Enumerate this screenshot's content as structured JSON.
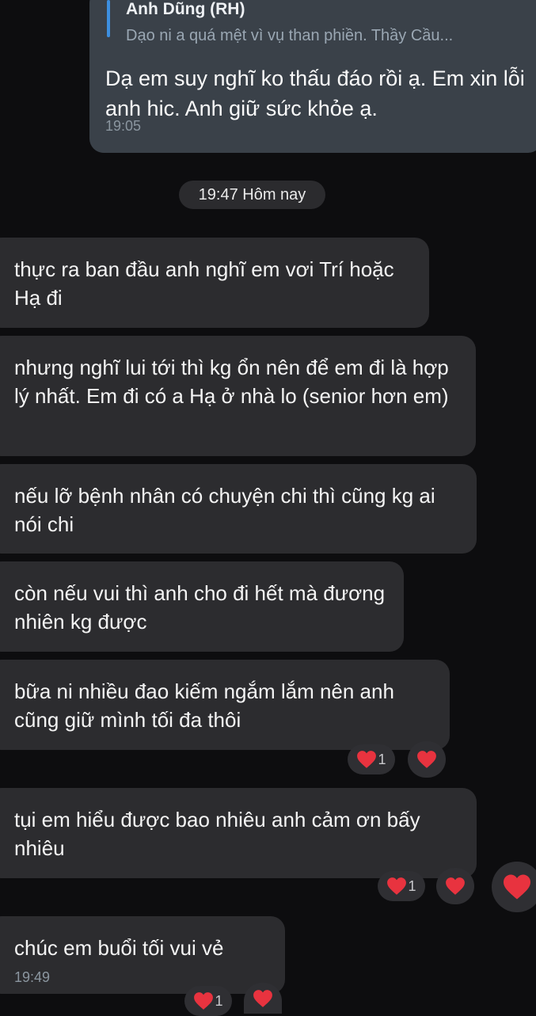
{
  "outgoing": {
    "reply_name": "Anh Dũng (RH)",
    "reply_text": "Dạo ni a quá mệt vì vụ than phiền. Thầy Cầu...",
    "text": "Dạ em suy nghĩ ko thấu đáo rồi ạ. Em xin lỗi anh hic. Anh giữ sức khỏe ạ.",
    "time": "19:05"
  },
  "date_separator": "19:47 Hôm nay",
  "messages": [
    {
      "text": "thực ra ban đầu anh nghĩ em vơi Trí hoặc Hạ đi"
    },
    {
      "text": "nhưng nghĩ lui tới thì kg ổn nên để em đi là hợp lý nhất. Em đi có a Hạ ở nhà lo (senior hơn em)"
    },
    {
      "text": "nếu lỡ bệnh nhân có chuyện chi thì cũng kg ai nói chi"
    },
    {
      "text": "còn nếu vui thì anh cho đi hết mà đương nhiên kg được"
    },
    {
      "text": "bữa ni nhiều đao kiếm ngắm lắm nên anh cũng giữ mình tối đa thôi",
      "reaction_count": "1"
    },
    {
      "text": "tụi em hiểu được bao nhiêu anh cảm ơn bấy nhiêu",
      "reaction_count": "1"
    },
    {
      "text": "chúc em buổi tối vui vẻ",
      "time": "19:49",
      "reaction_count": "1"
    }
  ],
  "icons": {
    "reaction": "red-heart-icon"
  },
  "colors": {
    "heart": "#e8333f",
    "incoming_bubble": "#2c2c2f",
    "outgoing_bubble": "#3a4149",
    "reply_bar": "#3d8fe0"
  }
}
